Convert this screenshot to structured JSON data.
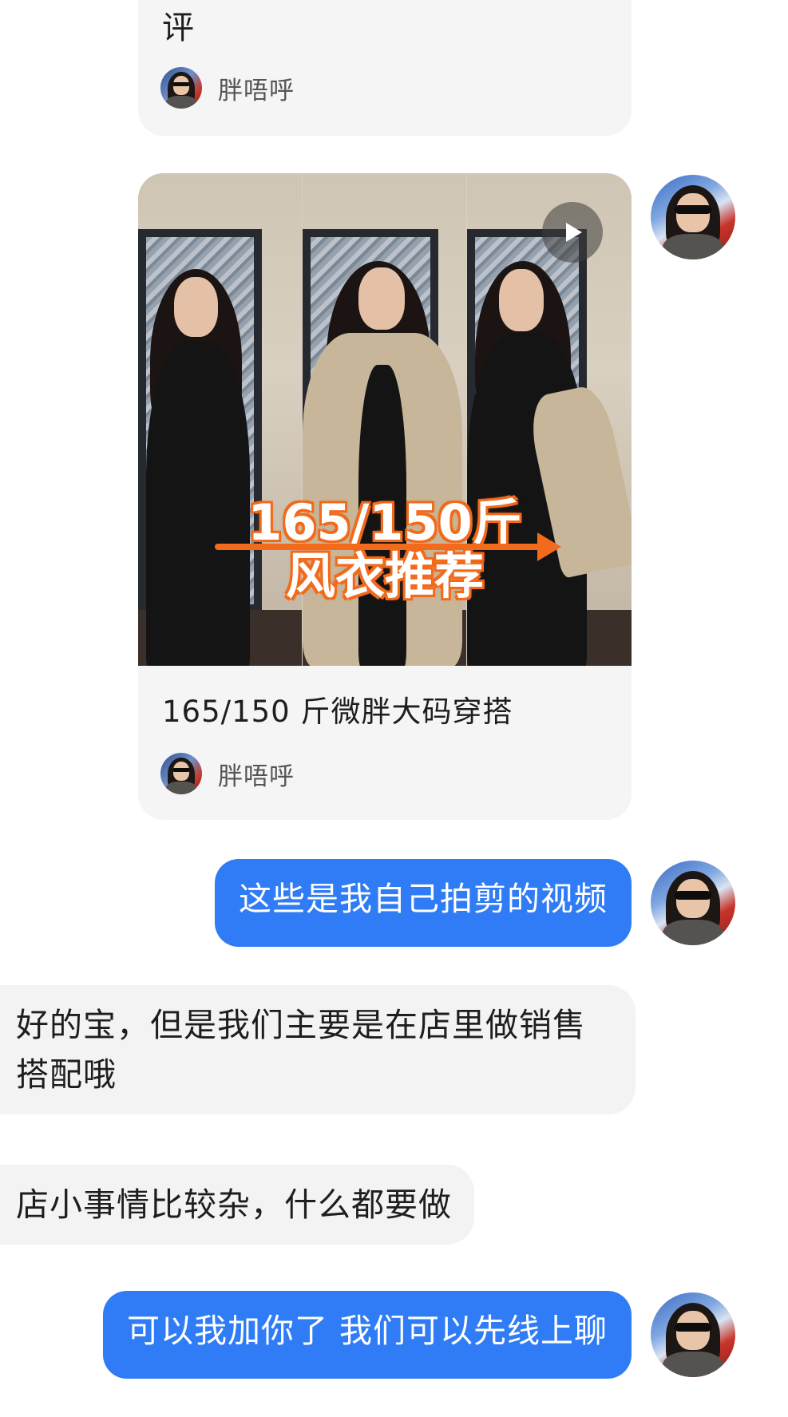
{
  "top_card": {
    "title_tail": "评",
    "author": "胖唔呼"
  },
  "video_card": {
    "overlay_line1": "165/150斤",
    "overlay_line2": "风衣推荐",
    "title": "165/150 斤微胖大码穿搭",
    "author": "胖唔呼"
  },
  "messages": {
    "out_1": "这些是我自己拍剪的视频",
    "in_1": "好的宝，但是我们主要是在店里做销售搭配哦",
    "in_2": "店小事情比较杂，什么都要做",
    "out_2": "可以我加你了 我们可以先线上聊"
  },
  "colors": {
    "outgoing_bubble": "#2f7cf6",
    "incoming_bubble": "#f3f3f3",
    "card_background": "#f5f5f5",
    "overlay_accent": "#f26a1b"
  },
  "icons": {
    "play": "play-icon"
  }
}
